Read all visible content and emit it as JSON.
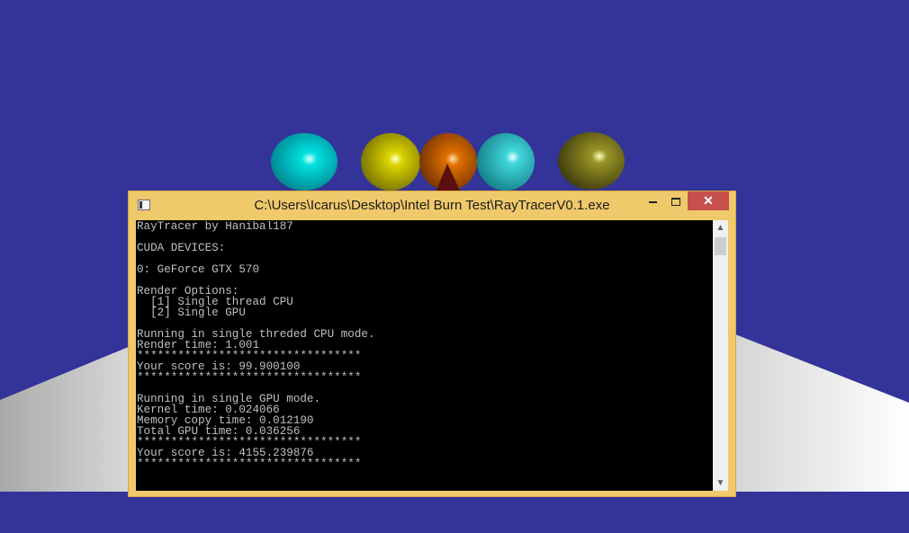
{
  "window": {
    "title": "C:\\Users\\Icarus\\Desktop\\Intel Burn Test\\RayTracerV0.1.exe",
    "minimize_icon": "minimize-icon",
    "maximize_icon": "maximize-icon",
    "close_glyph": "✕"
  },
  "console": {
    "lines": [
      "RayTracer by Hanibal187",
      "",
      "CUDA DEVICES:",
      "",
      "0: GeForce GTX 570",
      "",
      "Render Options:",
      "  [1] Single thread CPU",
      "  [2] Single GPU",
      "",
      "Running in single threded CPU mode.",
      "Render time: 1.001",
      "*********************************",
      "Your score is: 99.900100",
      "*********************************",
      "",
      "Running in single GPU mode.",
      "Kernel time: 0.024066",
      "Memory copy time: 0.012190",
      "Total GPU time: 0.036256",
      "*********************************",
      "Your score is: 4155.239876",
      "*********************************"
    ]
  },
  "scrollbar": {
    "up_glyph": "▲",
    "down_glyph": "▼"
  },
  "scene": {
    "background_color": "#333399",
    "sphere_colors": [
      "#00c6c8",
      "#c9c400",
      "#d46a00",
      "#2ec9cf",
      "#8a8a20"
    ]
  }
}
